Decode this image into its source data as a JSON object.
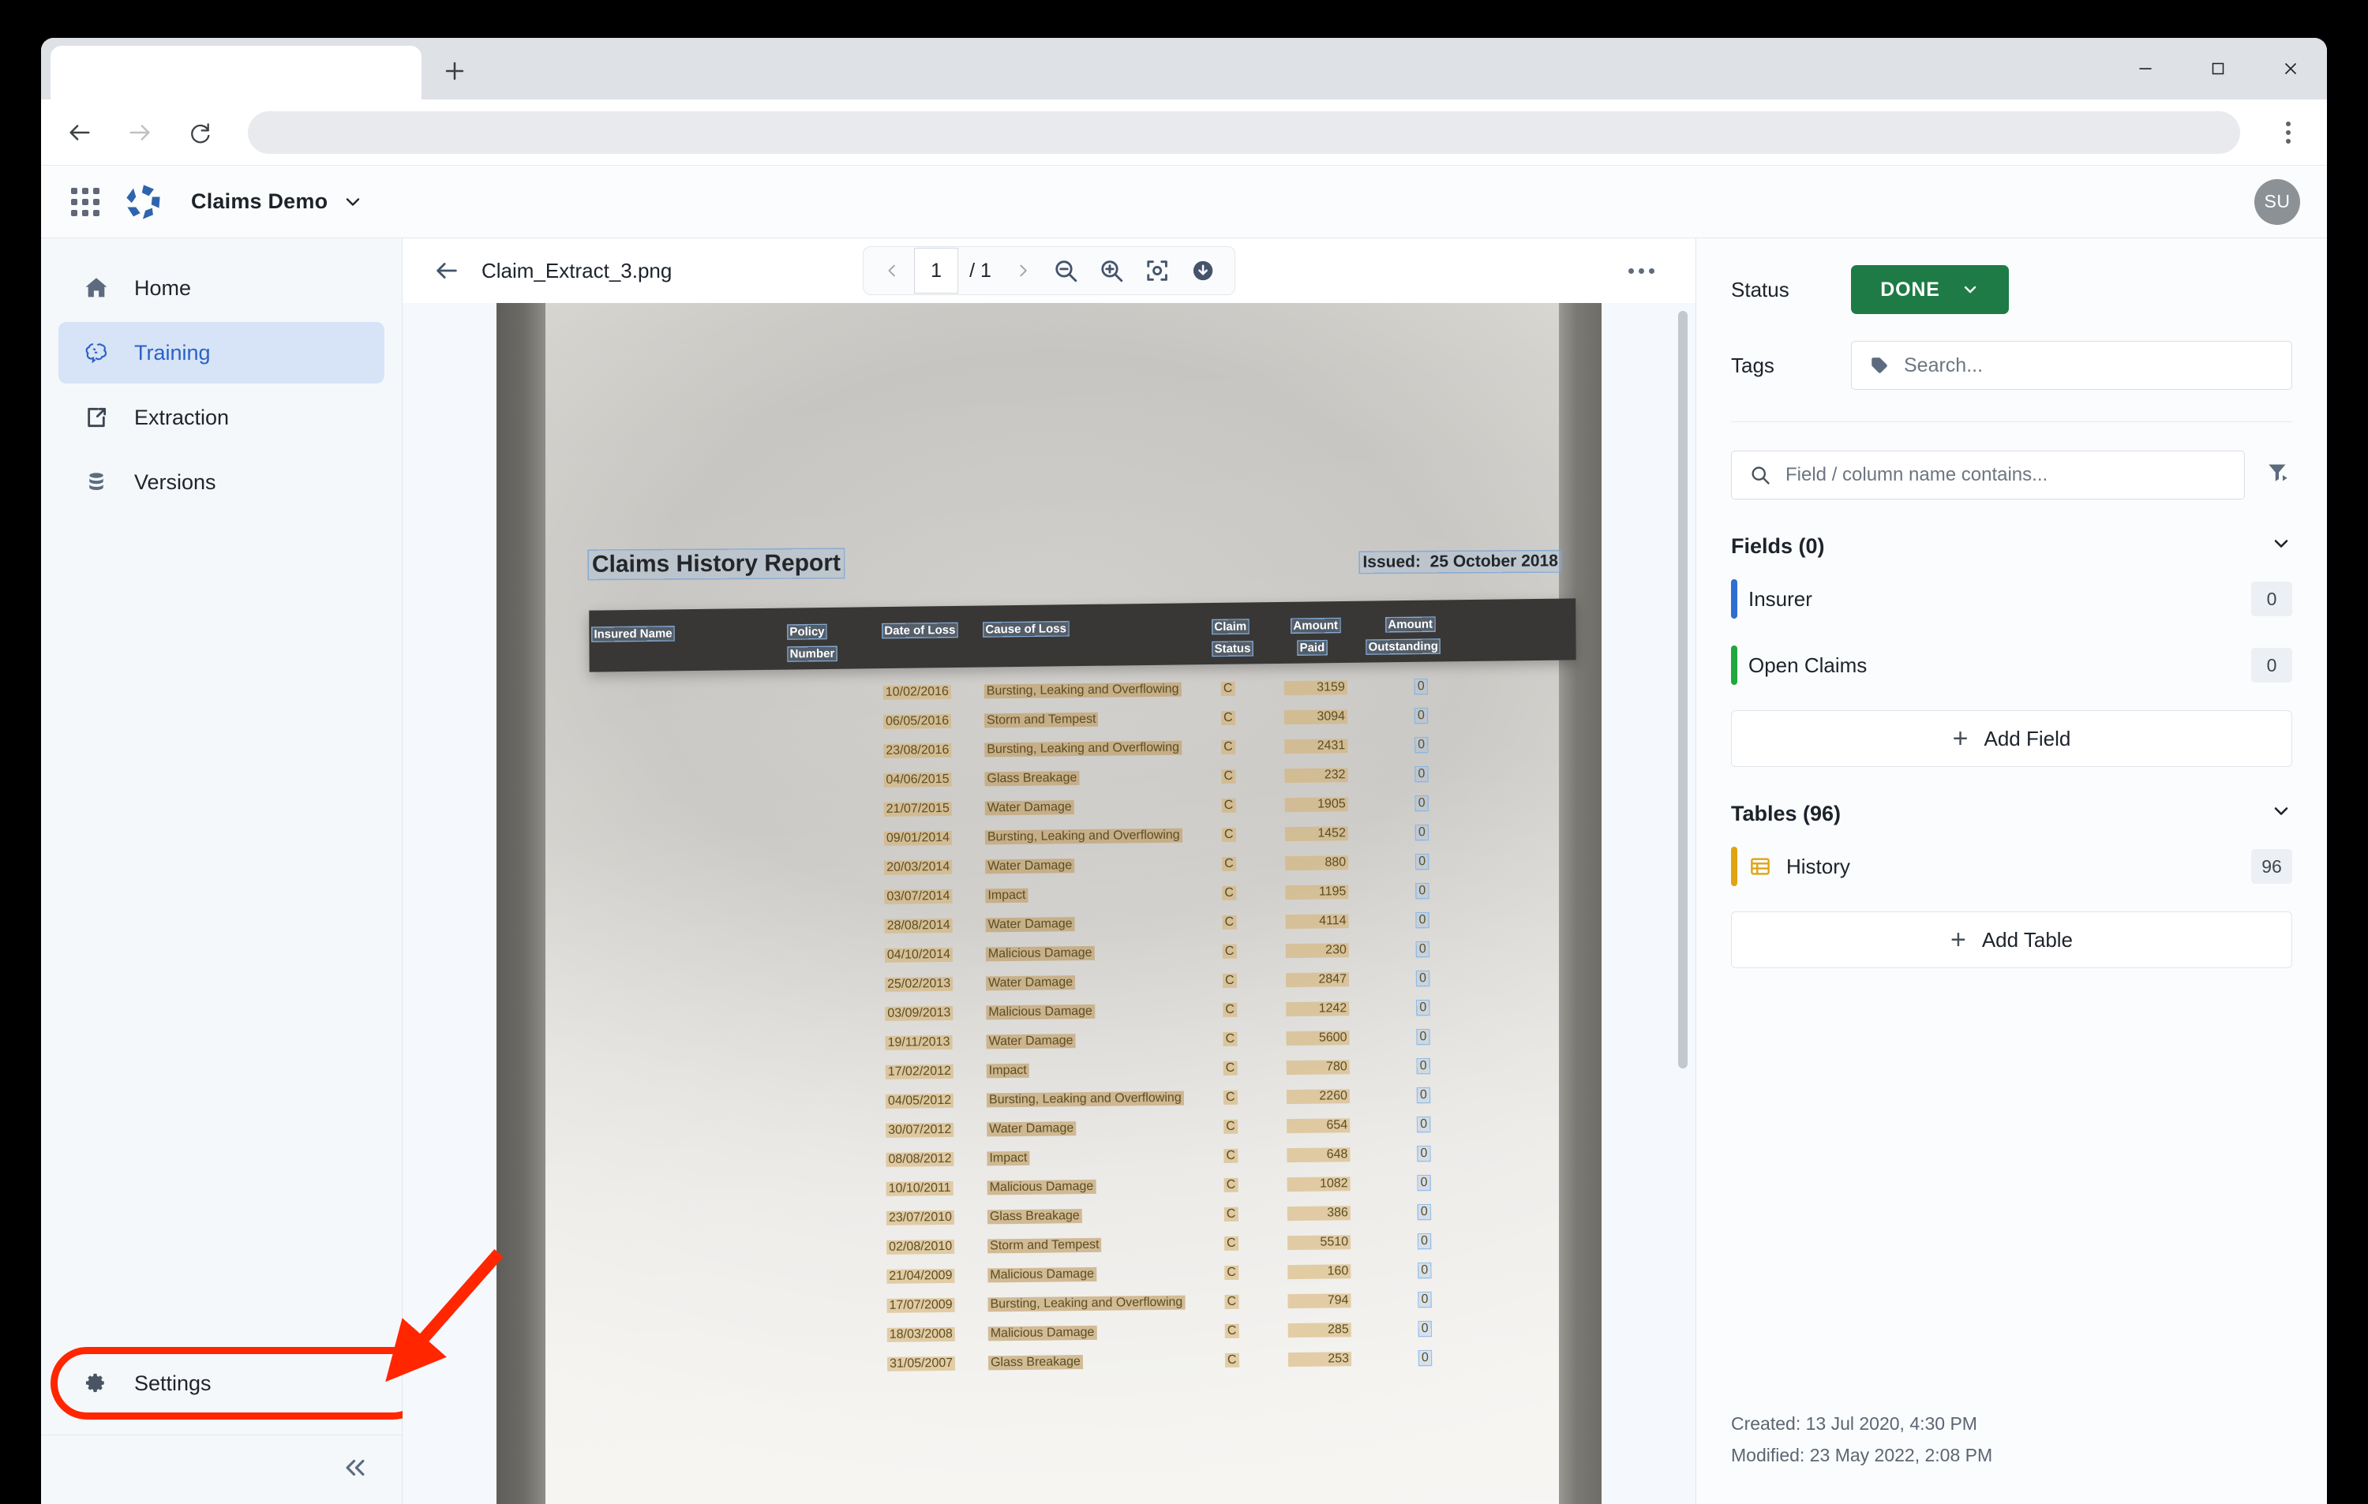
{
  "browser": {
    "tab_title": "",
    "url": "",
    "back_icon": "arrow-left-icon",
    "forward_icon": "arrow-right-icon",
    "reload_icon": "reload-icon",
    "new_tab_icon": "plus-icon",
    "menu_icon": "kebab-menu-icon",
    "minimize_icon": "minimize-icon",
    "maximize_icon": "maximize-icon",
    "close_icon": "close-icon"
  },
  "app_header": {
    "apps_grid_icon": "apps-grid-icon",
    "logo_icon": "brand-logo-icon",
    "workspace_name": "Claims Demo",
    "workspace_caret_icon": "chevron-down-icon",
    "avatar_initials": "SU"
  },
  "sidebar": {
    "items": [
      {
        "label": "Home",
        "icon": "home-icon",
        "active": false
      },
      {
        "label": "Training",
        "icon": "brain-icon",
        "active": true
      },
      {
        "label": "Extraction",
        "icon": "external-link-icon",
        "active": false
      },
      {
        "label": "Versions",
        "icon": "database-icon",
        "active": false
      }
    ],
    "settings": {
      "label": "Settings",
      "icon": "gear-icon",
      "highlighted": true
    },
    "collapse_icon": "chevrons-left-icon",
    "highlight_color": "#ff2600"
  },
  "annotation": {
    "arrow_color": "#ff2600",
    "target": "Settings"
  },
  "doc_viewer": {
    "back_icon": "arrow-left-icon",
    "filename": "Claim_Extract_3.png",
    "prev_page_icon": "chevron-left-icon",
    "next_page_icon": "chevron-right-icon",
    "page_number": "1",
    "page_total": "/ 1",
    "zoom_out_icon": "zoom-out-icon",
    "zoom_in_icon": "zoom-in-icon",
    "fit_screen_icon": "fit-to-screen-icon",
    "download_icon": "download-icon",
    "more_icon": "kebab-menu-icon"
  },
  "document": {
    "title": "Claims History Report",
    "issued_label": "Issued:",
    "issued_date": "25 October 2018",
    "columns": [
      "Insured Name",
      "Policy",
      "Number",
      "Date of Loss",
      "Cause of Loss",
      "Claim",
      "Status",
      "Amount",
      "Paid",
      "Amount",
      "Outstanding"
    ],
    "rows": [
      {
        "date": "10/02/2016",
        "cause": "Bursting, Leaking and Overflowing",
        "status": "C",
        "paid": "3159",
        "outstanding": "0"
      },
      {
        "date": "06/05/2016",
        "cause": "Storm and Tempest",
        "status": "C",
        "paid": "3094",
        "outstanding": "0"
      },
      {
        "date": "23/08/2016",
        "cause": "Bursting, Leaking and Overflowing",
        "status": "C",
        "paid": "2431",
        "outstanding": "0"
      },
      {
        "date": "04/06/2015",
        "cause": "Glass Breakage",
        "status": "C",
        "paid": "232",
        "outstanding": "0"
      },
      {
        "date": "21/07/2015",
        "cause": "Water Damage",
        "status": "C",
        "paid": "1905",
        "outstanding": "0"
      },
      {
        "date": "09/01/2014",
        "cause": "Bursting, Leaking and Overflowing",
        "status": "C",
        "paid": "1452",
        "outstanding": "0"
      },
      {
        "date": "20/03/2014",
        "cause": "Water Damage",
        "status": "C",
        "paid": "880",
        "outstanding": "0"
      },
      {
        "date": "03/07/2014",
        "cause": "Impact",
        "status": "C",
        "paid": "1195",
        "outstanding": "0"
      },
      {
        "date": "28/08/2014",
        "cause": "Water Damage",
        "status": "C",
        "paid": "4114",
        "outstanding": "0"
      },
      {
        "date": "04/10/2014",
        "cause": "Malicious Damage",
        "status": "C",
        "paid": "230",
        "outstanding": "0"
      },
      {
        "date": "25/02/2013",
        "cause": "Water Damage",
        "status": "C",
        "paid": "2847",
        "outstanding": "0"
      },
      {
        "date": "03/09/2013",
        "cause": "Malicious Damage",
        "status": "C",
        "paid": "1242",
        "outstanding": "0"
      },
      {
        "date": "19/11/2013",
        "cause": "Water Damage",
        "status": "C",
        "paid": "5600",
        "outstanding": "0"
      },
      {
        "date": "17/02/2012",
        "cause": "Impact",
        "status": "C",
        "paid": "780",
        "outstanding": "0"
      },
      {
        "date": "04/05/2012",
        "cause": "Bursting, Leaking and Overflowing",
        "status": "C",
        "paid": "2260",
        "outstanding": "0"
      },
      {
        "date": "30/07/2012",
        "cause": "Water Damage",
        "status": "C",
        "paid": "654",
        "outstanding": "0"
      },
      {
        "date": "08/08/2012",
        "cause": "Impact",
        "status": "C",
        "paid": "648",
        "outstanding": "0"
      },
      {
        "date": "10/10/2011",
        "cause": "Malicious Damage",
        "status": "C",
        "paid": "1082",
        "outstanding": "0"
      },
      {
        "date": "23/07/2010",
        "cause": "Glass Breakage",
        "status": "C",
        "paid": "386",
        "outstanding": "0"
      },
      {
        "date": "02/08/2010",
        "cause": "Storm and Tempest",
        "status": "C",
        "paid": "5510",
        "outstanding": "0"
      },
      {
        "date": "21/04/2009",
        "cause": "Malicious Damage",
        "status": "C",
        "paid": "160",
        "outstanding": "0"
      },
      {
        "date": "17/07/2009",
        "cause": "Bursting, Leaking and Overflowing",
        "status": "C",
        "paid": "794",
        "outstanding": "0"
      },
      {
        "date": "18/03/2008",
        "cause": "Malicious Damage",
        "status": "C",
        "paid": "285",
        "outstanding": "0"
      },
      {
        "date": "31/05/2007",
        "cause": "Glass Breakage",
        "status": "C",
        "paid": "253",
        "outstanding": "0"
      }
    ]
  },
  "right_panel": {
    "status_label": "Status",
    "status_value": "DONE",
    "status_color": "#1e7b45",
    "status_caret_icon": "chevron-down-icon",
    "tags_label": "Tags",
    "tags_icon": "tag-icon",
    "tags_placeholder": "Search...",
    "field_search_icon": "search-icon",
    "field_search_placeholder": "Field / column name contains...",
    "filter_icon": "filter-icon",
    "fields_section": {
      "title": "Fields (0)",
      "collapse_icon": "chevron-down-icon",
      "items": [
        {
          "name": "Insurer",
          "count": "0",
          "color": "#2f6fd0"
        },
        {
          "name": "Open Claims",
          "count": "0",
          "color": "#1fa83c"
        }
      ],
      "add_label": "Add Field"
    },
    "tables_section": {
      "title": "Tables (96)",
      "collapse_icon": "chevron-down-icon",
      "items": [
        {
          "name": "History",
          "count": "96",
          "color": "#e0a312",
          "icon": "table-icon"
        }
      ],
      "add_label": "Add Table"
    },
    "created": "Created: 13 Jul 2020, 4:30 PM",
    "modified": "Modified: 23 May 2022, 2:08 PM"
  }
}
